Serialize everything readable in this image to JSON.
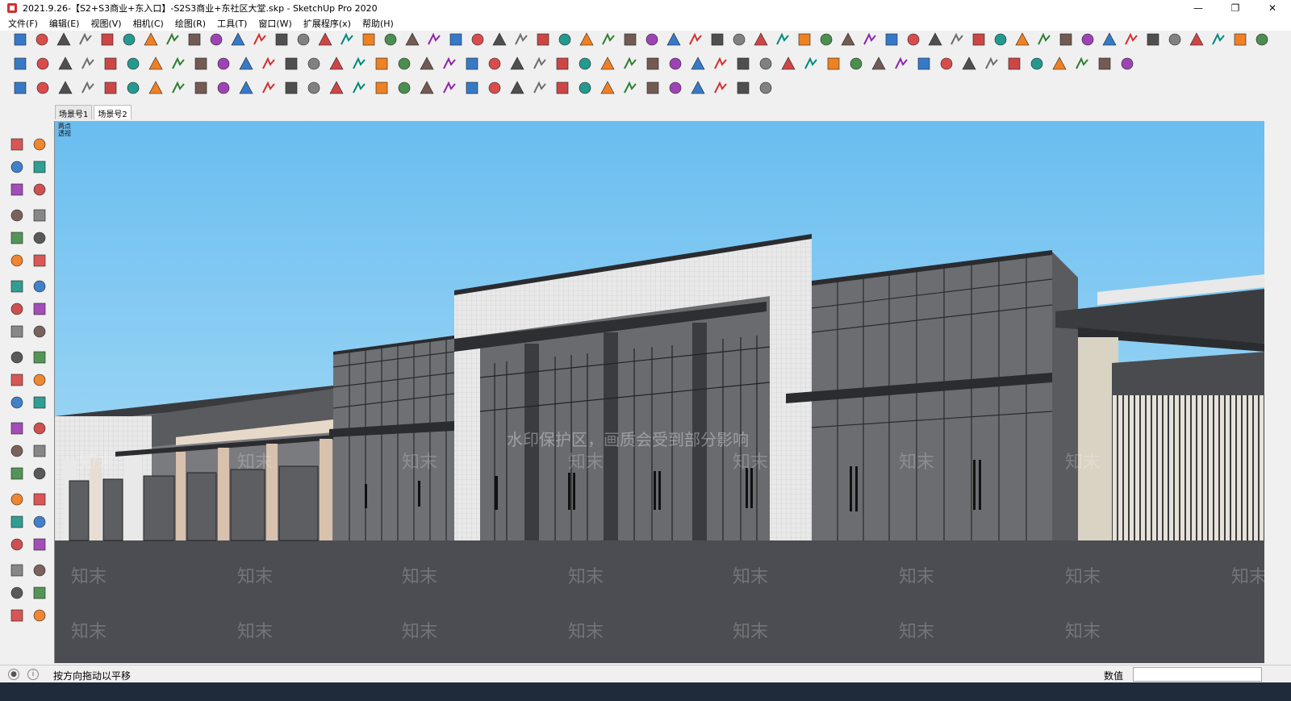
{
  "window": {
    "title": "2021.9.26-【S2+S3商业+东入口】-S2S3商业+东社区大堂.skp - SketchUp Pro 2020",
    "controls": [
      "—",
      "❐",
      "✕"
    ]
  },
  "menu": [
    "文件(F)",
    "编辑(E)",
    "视图(V)",
    "相机(C)",
    "绘图(R)",
    "工具(T)",
    "窗口(W)",
    "扩展程序(x)",
    "帮助(H)"
  ],
  "scenes": [
    "场景号1",
    "场景号2"
  ],
  "active_scene": "场景号2",
  "camera_label": [
    "两点",
    "透视"
  ],
  "watermark": {
    "banner": "水印保护区，画质会受到部分影响",
    "brand": "知末"
  },
  "status": {
    "message": "按方向拖动以平移",
    "measurements_label": "数值",
    "measurements_value": ""
  },
  "colors": {
    "sky": "#6fbfee",
    "ground": "#4b4d52",
    "glass": "#6e6f73",
    "frame": "#3a3b3f",
    "panel_light": "#e8e8e8"
  }
}
